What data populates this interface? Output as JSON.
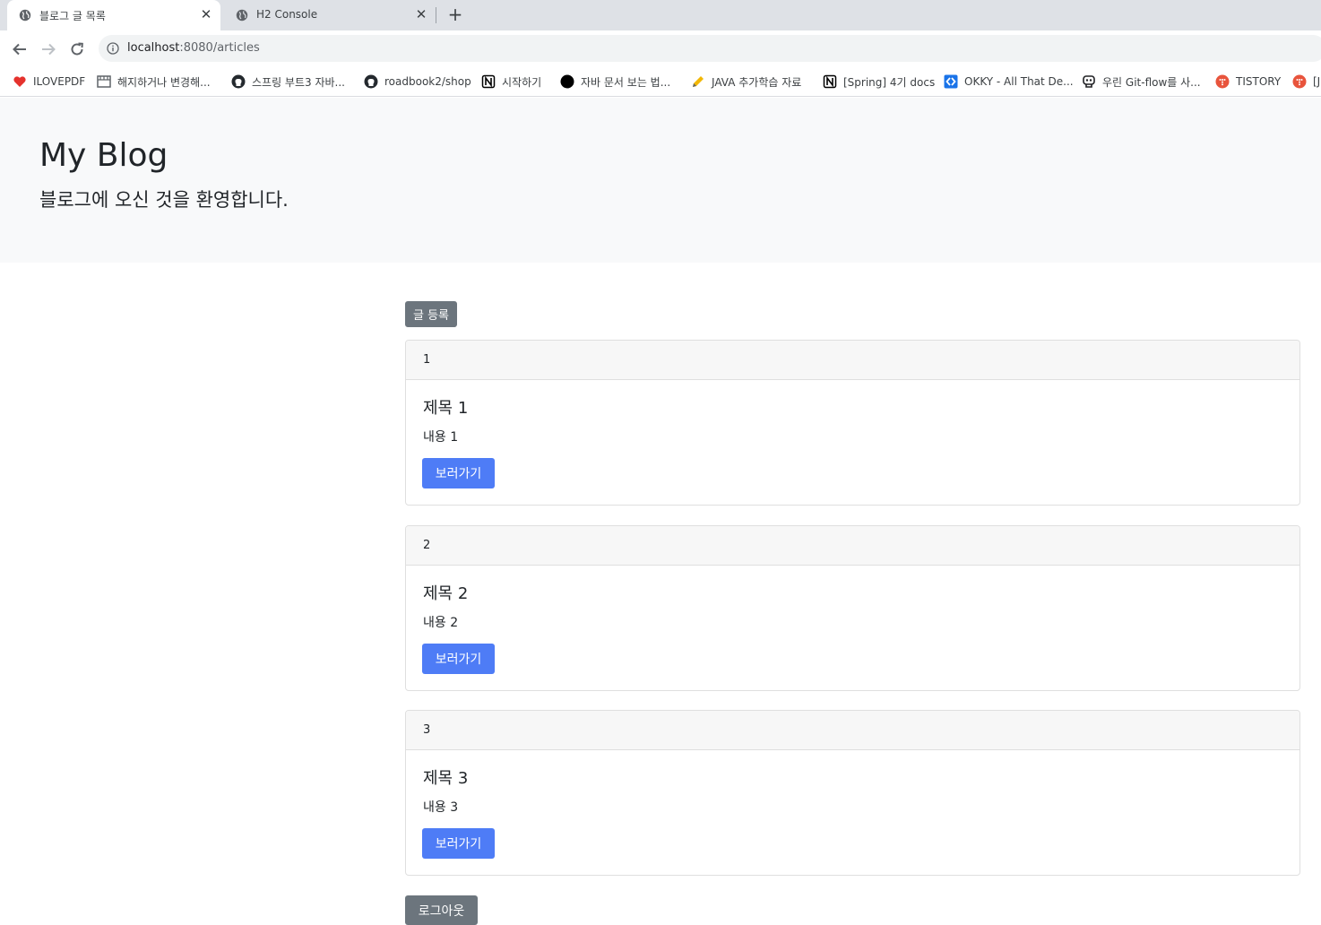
{
  "browser": {
    "tabs": [
      {
        "title": "블로그 글 목록",
        "active": true,
        "icon": "globe-icon"
      },
      {
        "title": "H2 Console",
        "active": false,
        "icon": "globe-icon"
      }
    ],
    "url_host": "localhost",
    "url_rest": ":8080/articles",
    "bookmarks": [
      {
        "label": "ILOVEPDF",
        "icon": "heart-icon",
        "color": "#e5322d"
      },
      {
        "label": "해지하거나 변경해...",
        "icon": "film-icon",
        "color": "#5f6368"
      },
      {
        "label": "스프링 부트3 자바...",
        "icon": "github-icon",
        "color": "#24292e"
      },
      {
        "label": "roadbook2/shop",
        "icon": "github-icon",
        "color": "#24292e"
      },
      {
        "label": "시작하기",
        "icon": "notion-icon",
        "color": "#000000"
      },
      {
        "label": "자바 문서 보는 법...",
        "icon": "circle-icon",
        "color": "#000000"
      },
      {
        "label": "JAVA 추가학습 자료",
        "icon": "pencil-icon",
        "color": "#f2b705"
      },
      {
        "label": "[Spring] 4기 docs",
        "icon": "notion-icon",
        "color": "#000000"
      },
      {
        "label": "OKKY - All That De...",
        "icon": "okky-icon",
        "color": "#1a73e8"
      },
      {
        "label": "우린 Git-flow를 사...",
        "icon": "robot-icon",
        "color": "#202124"
      },
      {
        "label": "TISTORY",
        "icon": "tistory-icon",
        "color": "#e8543c"
      },
      {
        "label": "[J",
        "icon": "tistory-icon",
        "color": "#e8543c"
      }
    ]
  },
  "jumbotron": {
    "title": "My Blog",
    "subtitle": "블로그에 오신 것을 환영합니다."
  },
  "actions": {
    "write_label": "글 등록",
    "logout_label": "로그아웃"
  },
  "articles": [
    {
      "id": "1",
      "title": "제목 1",
      "content": "내용 1",
      "button": "보러가기"
    },
    {
      "id": "2",
      "title": "제목 2",
      "content": "내용 2",
      "button": "보러가기"
    },
    {
      "id": "3",
      "title": "제목 3",
      "content": "내용 3",
      "button": "보러가기"
    }
  ]
}
